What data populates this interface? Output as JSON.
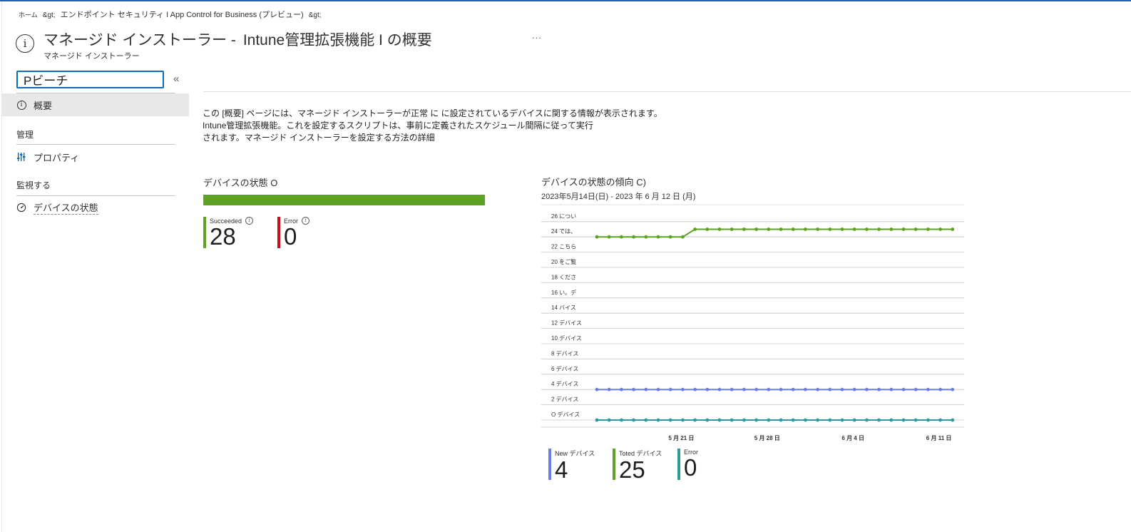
{
  "breadcrumb": {
    "home": "ホーム",
    "sep1": "&gt;",
    "path": "エンドポイント セキュリティ I App Control for Business (プレビュー)",
    "sep2": "&gt;"
  },
  "header": {
    "icon": "info-icon",
    "title_part1": "マネージド インストーラー -",
    "title_part2": "Intune管理拡張機能 I の概要",
    "subtitle": "マネージド インストーラー",
    "more": "..."
  },
  "sidebar": {
    "search_value": "Pビーチ",
    "collapse": "«",
    "overview_label": "概要",
    "group_manage": "管理",
    "properties_label": "プロパティ",
    "group_monitor": "監視する",
    "device_status_label": "デバイスの状態"
  },
  "main": {
    "desc_line1": "この [概要] ページには、マネージド インストーラーが正常 に に設定されているデバイスに関する情報が表示されます。",
    "desc_line2": "Intune管理拡張機能。これを設定するスクリプトは、事前に定義されたスケジュール間隔に従って実行",
    "desc_line3": "されます。マネージド インストーラーを設定する方法の詳細",
    "device_status": {
      "title": "デバイスの状態 O",
      "bar_color": "#5ea224",
      "succeeded_label": "Succeeded",
      "succeeded_value": "28",
      "succeeded_color": "#5ea224",
      "error_label": "Error",
      "error_value": "0",
      "error_color": "#c50f1f",
      "succeeded_fraction": 1.0
    },
    "trend": {
      "title": "デバイスの状態の傾向 C)",
      "date_range": "2023年5月14日(日) -   2023 年 6 月 12 日 (月)",
      "legend": [
        {
          "label": "New デバイス",
          "value": "4",
          "color": "#6b7de0"
        },
        {
          "label": "Toted デバイス",
          "value": "25",
          "color": "#5ea224"
        },
        {
          "label": "Error",
          "value": "0",
          "color": "#2e9aa0"
        }
      ]
    }
  },
  "chart_data": {
    "type": "line",
    "title": "デバイスの状態の傾向 C)",
    "y_ticks": [
      {
        "value": 26,
        "label": "26 につい"
      },
      {
        "value": 24,
        "label": "24 では、"
      },
      {
        "value": 22,
        "label": "22 こちら"
      },
      {
        "value": 20,
        "label": "20 をご覧"
      },
      {
        "value": 18,
        "label": "18 くださ"
      },
      {
        "value": 16,
        "label": "16 い。デ"
      },
      {
        "value": 14,
        "label": "14 バイス"
      },
      {
        "value": 12,
        "label": "12 デバイス"
      },
      {
        "value": 10,
        "label": "10 デバイス"
      },
      {
        "value": 8,
        "label": "8 デバイス"
      },
      {
        "value": 6,
        "label": "6 デバイス"
      },
      {
        "value": 4,
        "label": "4 デバイス"
      },
      {
        "value": 2,
        "label": "2 デバイス"
      },
      {
        "value": 0,
        "label": "O デバイス"
      }
    ],
    "ylim": [
      0,
      26
    ],
    "x_start": "2023-05-14",
    "x_end": "2023-06-12",
    "x_ticks": [
      {
        "day": 7,
        "label": "5 月 21 日"
      },
      {
        "day": 14,
        "label": "5 月 28 日"
      },
      {
        "day": 21,
        "label": "6 月 4 日"
      },
      {
        "day": 28,
        "label": "6 月 11 日"
      }
    ],
    "x_days": [
      0,
      1,
      2,
      3,
      4,
      5,
      6,
      7,
      8,
      9,
      10,
      11,
      12,
      13,
      14,
      15,
      16,
      17,
      18,
      19,
      20,
      21,
      22,
      23,
      24,
      25,
      26,
      27,
      28,
      29
    ],
    "series": [
      {
        "name": "Toted デバイス",
        "color": "#5ea224",
        "values": [
          24,
          24,
          24,
          24,
          24,
          24,
          24,
          24,
          25,
          25,
          25,
          25,
          25,
          25,
          25,
          25,
          25,
          25,
          25,
          25,
          25,
          25,
          25,
          25,
          25,
          25,
          25,
          25,
          25,
          25
        ]
      },
      {
        "name": "New デバイス",
        "color": "#6b7de0",
        "values": [
          4,
          4,
          4,
          4,
          4,
          4,
          4,
          4,
          4,
          4,
          4,
          4,
          4,
          4,
          4,
          4,
          4,
          4,
          4,
          4,
          4,
          4,
          4,
          4,
          4,
          4,
          4,
          4,
          4,
          4
        ]
      },
      {
        "name": "Error",
        "color": "#2e9aa0",
        "values": [
          0,
          0,
          0,
          0,
          0,
          0,
          0,
          0,
          0,
          0,
          0,
          0,
          0,
          0,
          0,
          0,
          0,
          0,
          0,
          0,
          0,
          0,
          0,
          0,
          0,
          0,
          0,
          0,
          0,
          0
        ]
      }
    ],
    "grid": true
  }
}
